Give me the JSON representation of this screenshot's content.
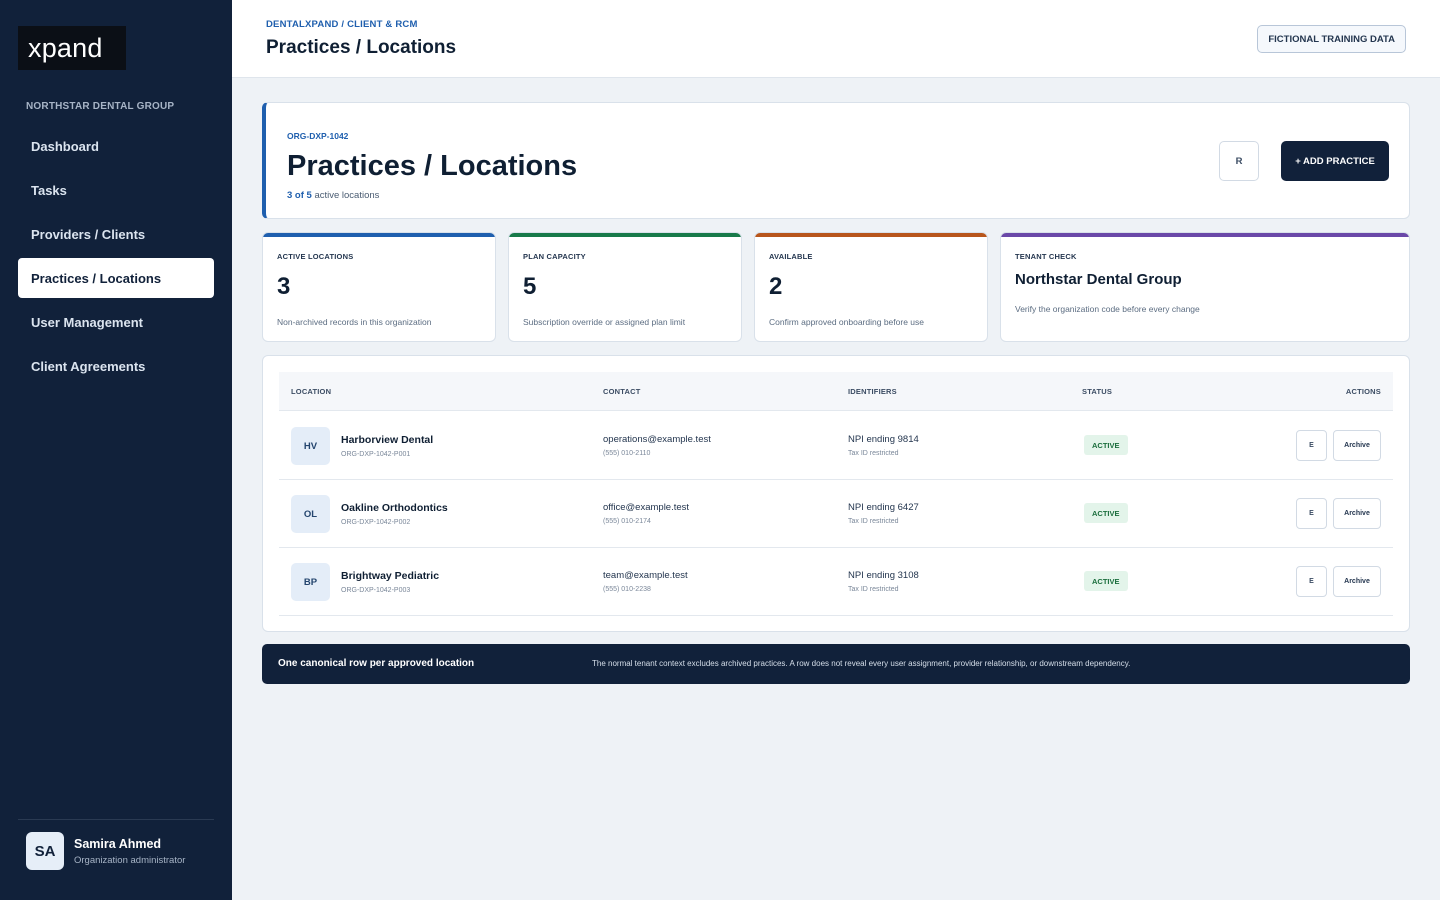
{
  "sidebar": {
    "logo": "xpand",
    "org_label": "NORTHSTAR DENTAL GROUP",
    "items": [
      {
        "label": "Dashboard"
      },
      {
        "label": "Tasks"
      },
      {
        "label": "Providers / Clients"
      },
      {
        "label": "Practices / Locations",
        "active": true
      },
      {
        "label": "User Management"
      },
      {
        "label": "Client Agreements"
      }
    ],
    "user": {
      "initials": "SA",
      "name": "Samira Ahmed",
      "role": "Organization administrator"
    }
  },
  "header": {
    "breadcrumb": "DENTALXPAND / CLIENT & RCM",
    "title": "Practices / Locations",
    "badge": "FICTIONAL TRAINING DATA"
  },
  "hero": {
    "code": "ORG-DXP-1042",
    "title": "Practices / Locations",
    "count_text": "3 of 5",
    "count_suffix": " active locations",
    "r_button": "R",
    "add_button": "+ ADD PRACTICE"
  },
  "stats": [
    {
      "label": "ACTIVE LOCATIONS",
      "value": "3",
      "note": "Non-archived records in this organization",
      "color": "#1f5fae"
    },
    {
      "label": "PLAN CAPACITY",
      "value": "5",
      "note": "Subscription override or assigned plan limit",
      "color": "#187a4a"
    },
    {
      "label": "AVAILABLE",
      "value": "2",
      "note": "Confirm approved onboarding before use",
      "color": "#b8561c"
    }
  ],
  "tenant": {
    "label": "TENANT CHECK",
    "org": "Northstar Dental Group",
    "note": "Verify the organization code before every change",
    "color": "#6a48a8"
  },
  "table": {
    "columns": {
      "location": "LOCATION",
      "contact": "CONTACT",
      "identifiers": "IDENTIFIERS",
      "status": "STATUS",
      "actions": "ACTIONS"
    },
    "rows": [
      {
        "initials": "HV",
        "name": "Harborview Dental",
        "code": "ORG-DXP-1042-P001",
        "email": "operations@example.test",
        "phone": "(555) 010-2110",
        "npi": "NPI ending 9814",
        "tax": "Tax ID restricted",
        "status": "ACTIVE",
        "edit": "E",
        "archive": "Archive"
      },
      {
        "initials": "OL",
        "name": "Oakline Orthodontics",
        "code": "ORG-DXP-1042-P002",
        "email": "office@example.test",
        "phone": "(555) 010-2174",
        "npi": "NPI ending 6427",
        "tax": "Tax ID restricted",
        "status": "ACTIVE",
        "edit": "E",
        "archive": "Archive"
      },
      {
        "initials": "BP",
        "name": "Brightway Pediatric",
        "code": "ORG-DXP-1042-P003",
        "email": "team@example.test",
        "phone": "(555) 010-2238",
        "npi": "NPI ending 3108",
        "tax": "Tax ID restricted",
        "status": "ACTIVE",
        "edit": "E",
        "archive": "Archive"
      }
    ]
  },
  "banner": {
    "title": "One canonical row per approved location",
    "text": "The normal tenant context excludes archived practices. A row does not reveal every user assignment, provider relationship, or downstream dependency."
  }
}
